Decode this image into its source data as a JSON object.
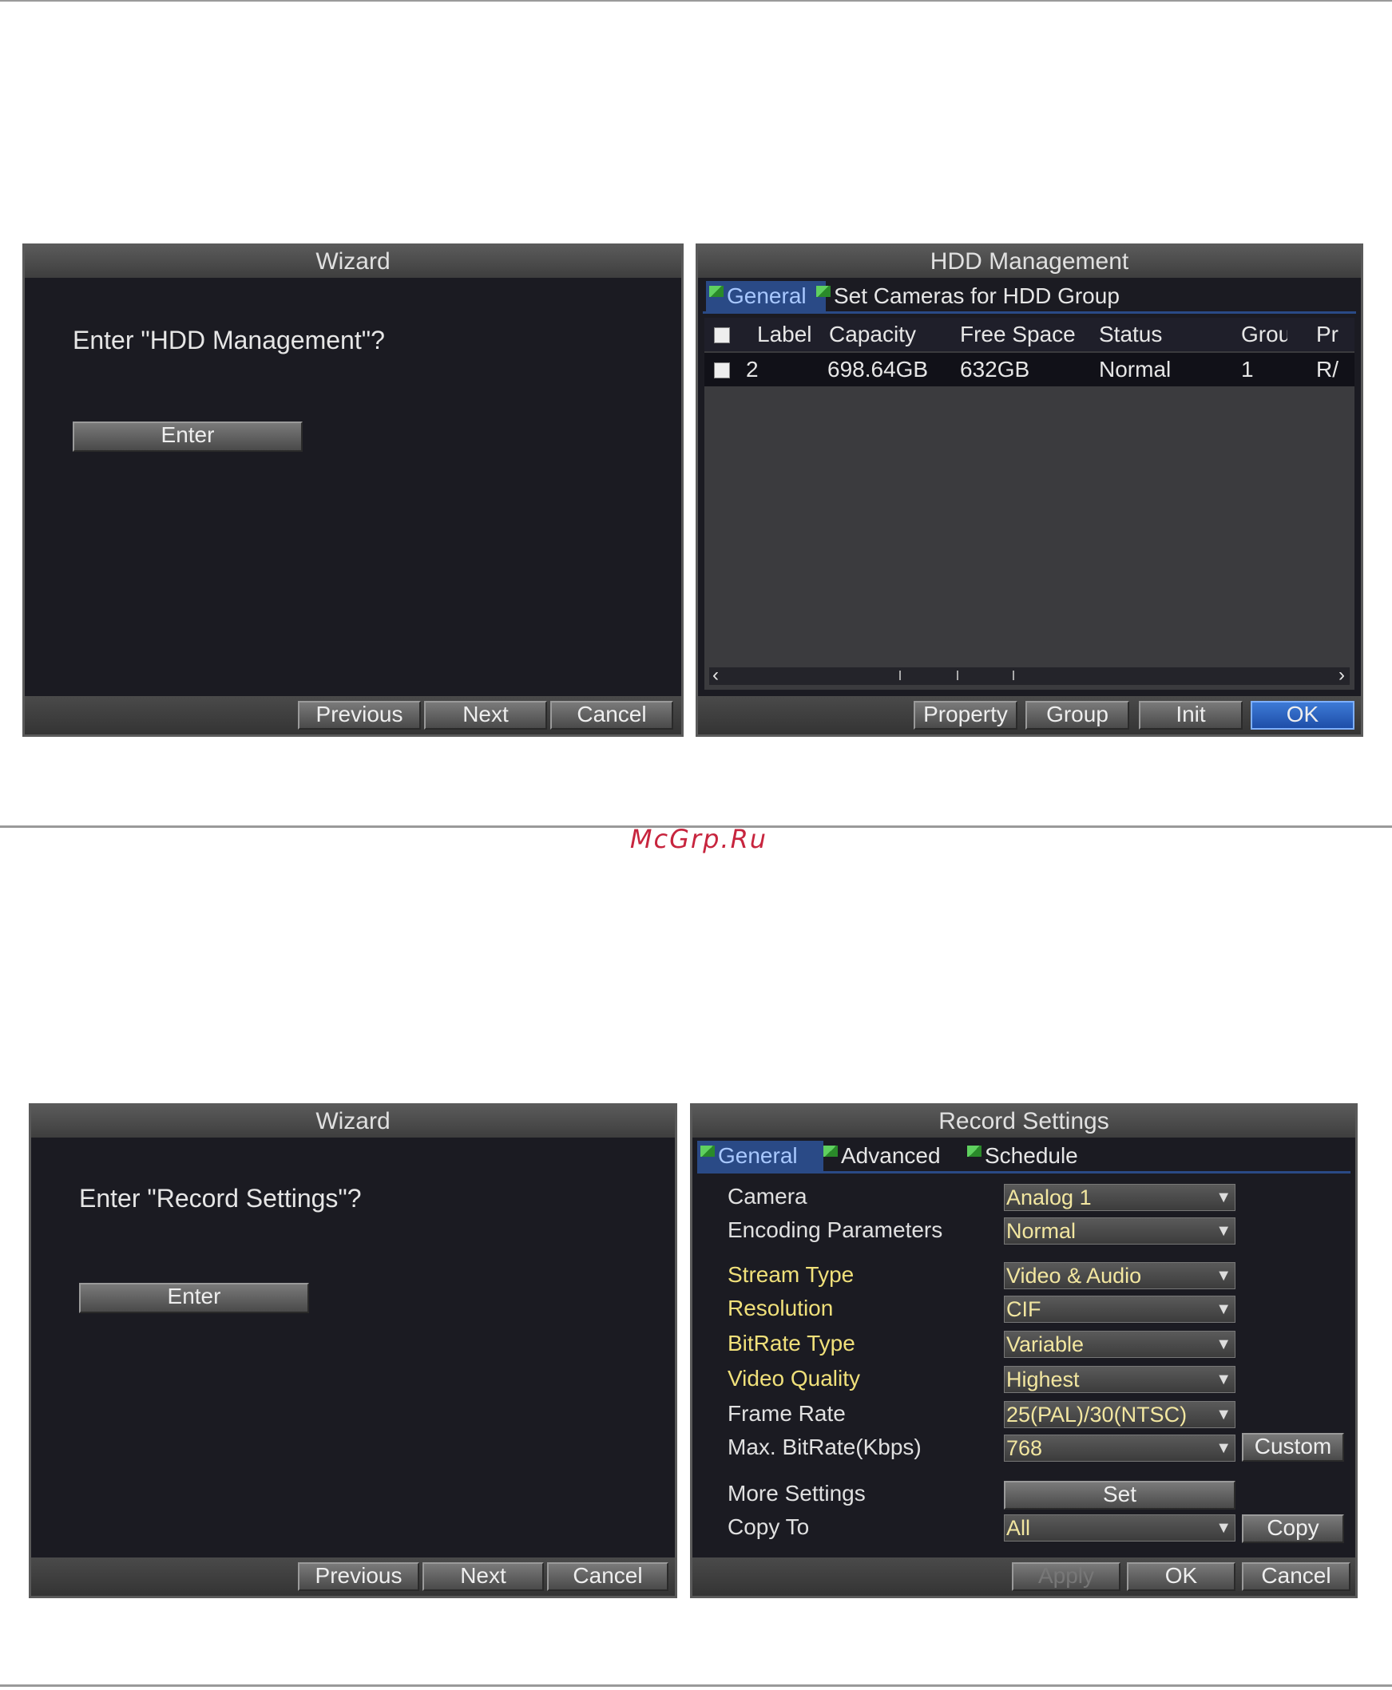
{
  "watermark": "McGrp.Ru",
  "wizard1": {
    "title": "Wizard",
    "question": "Enter \"HDD Management\"?",
    "enter": "Enter",
    "previous": "Previous",
    "next": "Next",
    "cancel": "Cancel"
  },
  "hdd": {
    "title": "HDD Management",
    "tabs": [
      "General",
      "Set Cameras for HDD Group"
    ],
    "columns": {
      "label": "Label",
      "capacity": "Capacity",
      "free_space": "Free Space",
      "status": "Status",
      "group": "Grou",
      "pr": "Pr"
    },
    "row": {
      "label": "2",
      "capacity": "698.64GB",
      "free_space": "632GB",
      "status": "Normal",
      "group": "1",
      "pr": "R/"
    },
    "buttons": {
      "property": "Property",
      "group": "Group",
      "init": "Init",
      "ok": "OK"
    }
  },
  "wizard2": {
    "title": "Wizard",
    "question": "Enter \"Record Settings\"?",
    "enter": "Enter",
    "previous": "Previous",
    "next": "Next",
    "cancel": "Cancel"
  },
  "record": {
    "title": "Record Settings",
    "tabs": [
      "General",
      "Advanced",
      "Schedule"
    ],
    "fields": {
      "camera": {
        "label": "Camera",
        "value": "Analog 1"
      },
      "encoding": {
        "label": "Encoding Parameters",
        "value": "Normal"
      },
      "stream_type": {
        "label": "Stream Type",
        "value": "Video & Audio"
      },
      "resolution": {
        "label": "Resolution",
        "value": "CIF"
      },
      "bitrate_type": {
        "label": "BitRate Type",
        "value": "Variable"
      },
      "video_quality": {
        "label": "Video Quality",
        "value": "Highest"
      },
      "frame_rate": {
        "label": "Frame Rate",
        "value": "25(PAL)/30(NTSC)"
      },
      "max_bitrate": {
        "label": "Max. BitRate(Kbps)",
        "value": "768"
      },
      "more_settings": {
        "label": "More Settings"
      },
      "copy_to": {
        "label": "Copy To",
        "value": "All"
      }
    },
    "buttons": {
      "custom": "Custom",
      "set": "Set",
      "copy": "Copy",
      "apply": "Apply",
      "ok": "OK",
      "cancel": "Cancel"
    }
  }
}
